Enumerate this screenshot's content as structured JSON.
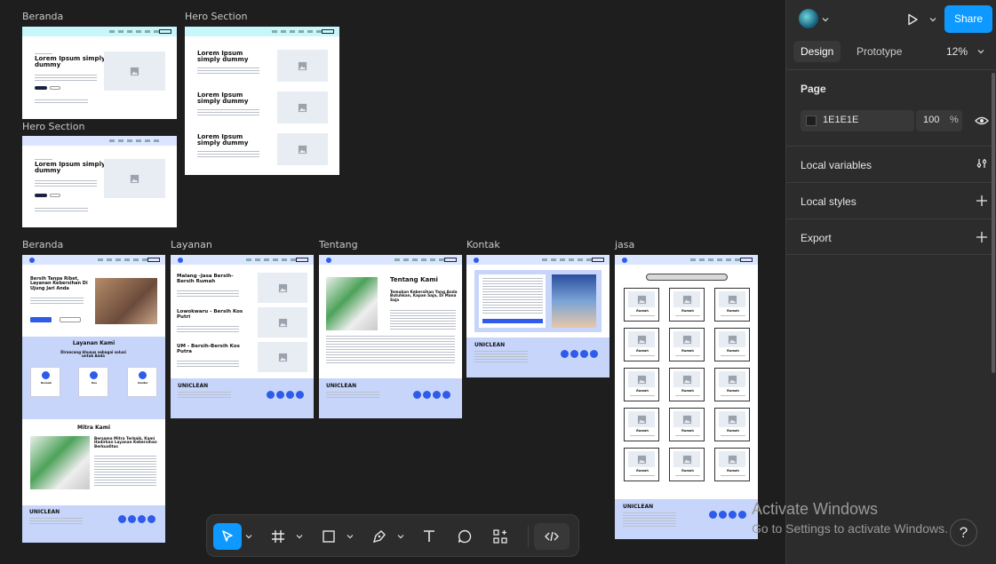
{
  "frames": {
    "beranda_top": "Beranda",
    "hero_section_top": "Hero Section",
    "hero_section_mid": "Hero Section",
    "beranda": "Beranda",
    "layanan": "Layanan",
    "tentang": "Tentang",
    "kontak": "Kontak",
    "jasa": "jasa"
  },
  "mock": {
    "hero_title": "Lorem Ipsum simply dummy",
    "brand": "UNICLEAN",
    "beranda_hero": "Bersih Tanpa Ribet, Layanan Kebersihan Di Ujung Jari Anda",
    "layanan_kami": "Layanan Kami",
    "layanan_sub": "Dirancang khusus sebagai solusi untuk Anda",
    "mitra_kami": "Mitra Kami",
    "mitra_heading": "Bersama Mitra Terbaik, Kami Hadirkan Layanan Kebersihan Berkualitas",
    "layanan_1": "Malang -Jasa Bersih-Bersih Rumah",
    "layanan_2": "Lowokwaru - Bersih Kos Putri",
    "layanan_3": "UM - Bersih-Bersih Kos Putra",
    "tentang_title": "Tentang Kami",
    "tentang_sub": "Temukan Kebersihan Yang Anda Butuhkan, Kapan Saja, Di Mana Saja",
    "card_label": "Rumah",
    "svc_1": "Rumah",
    "svc_2": "Kos",
    "svc_3": "Kantor"
  },
  "panel": {
    "share": "Share",
    "tab_design": "Design",
    "tab_prototype": "Prototype",
    "zoom": "12%",
    "page_label": "Page",
    "page_color": "1E1E1E",
    "page_opacity": "100",
    "percent": "%",
    "local_variables": "Local variables",
    "local_styles": "Local styles",
    "export": "Export"
  },
  "watermark": {
    "line1": "Activate Windows",
    "line2": "Go to Settings to activate Windows."
  },
  "help": "?",
  "colors": {
    "canvas": "#1E1E1E",
    "accent": "#0D99FF",
    "mock_blue": "#2F5BEA",
    "mock_light": "#C7D5FB"
  }
}
